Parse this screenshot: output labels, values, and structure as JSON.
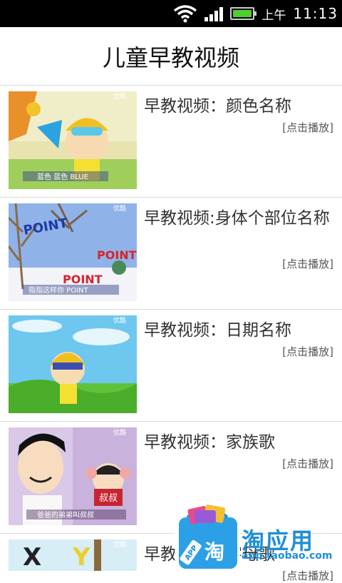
{
  "status_bar": {
    "am_pm": "上午",
    "time": "11:13"
  },
  "header": {
    "title": "儿童早教视频"
  },
  "play_label": "[点击播放]",
  "videos": [
    {
      "title": "早教视频：颜色名称"
    },
    {
      "title": "早教视频:身体个部位名称"
    },
    {
      "title": "早教视频：日期名称"
    },
    {
      "title": "早教视频：家族歌"
    },
    {
      "title": "早教视频：字母歌"
    }
  ],
  "thumbnails": {
    "t1_caption": "蓝色 蓝色 BLUE",
    "t2_words": [
      "POINT",
      "POINT",
      "POINT"
    ],
    "t2_caption": "指指这样你 POINT",
    "t4_sign": "叔叔",
    "t4_caption": "爸爸的弟弟叫叔叔",
    "watermark": "优酷",
    "t5_letters": [
      "X",
      "Y"
    ]
  },
  "promo": {
    "name": "淘应用",
    "url": "app.taobao.com",
    "badge": "APP",
    "icon_char": "淘"
  },
  "colors": {
    "promo_blue": "#1e8fd6",
    "battery_green": "#4fcf2c"
  }
}
